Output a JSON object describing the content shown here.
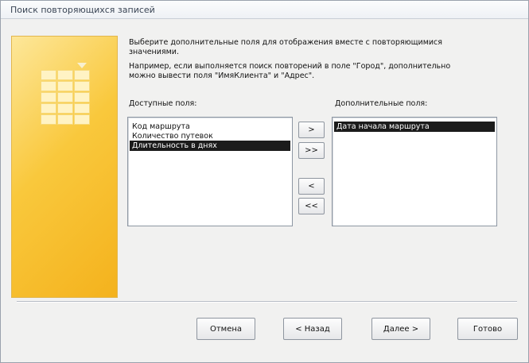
{
  "window": {
    "title": "Поиск повторяющихся записей"
  },
  "instructions": {
    "line1": "Выберите дополнительные поля для отображения вместе с повторяющимися",
    "line2": "значениями.",
    "line3": "Например, если выполняется поиск повторений в поле \"Город\", дополнительно",
    "line4": "можно вывести поля \"ИмяКлиента\" и \"Адрес\"."
  },
  "available": {
    "label": "Доступные поля:",
    "items": [
      {
        "text": "Код маршрута",
        "selected": false
      },
      {
        "text": "Количество путевок",
        "selected": false
      },
      {
        "text": "Длительность в днях",
        "selected": true
      }
    ]
  },
  "additional": {
    "label": "Дополнительные поля:",
    "items": [
      {
        "text": "Дата начала маршрута",
        "selected": true
      }
    ]
  },
  "move_buttons": {
    "add_one": ">",
    "add_all": ">>",
    "remove_one": "<",
    "remove_all": "<<"
  },
  "footer": {
    "cancel": "Отмена",
    "back": "< Назад",
    "next": "Далее >",
    "finish": "Готово"
  },
  "icons": {
    "wizard_art": "wizard-table-illustration"
  }
}
